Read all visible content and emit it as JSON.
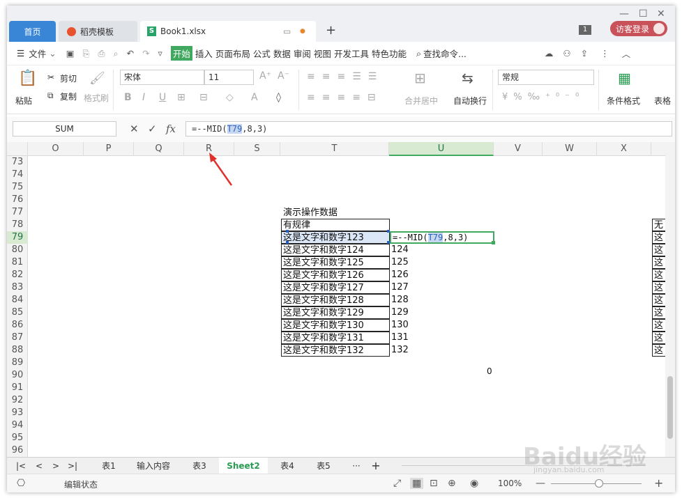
{
  "window": {
    "tabs": [
      {
        "label": "首页"
      },
      {
        "label": "稻壳模板"
      },
      {
        "label": "Book1.xlsx"
      }
    ],
    "notif_count": "1",
    "login_label": "访客登录"
  },
  "menu": {
    "items": [
      "文件",
      "开始",
      "插入",
      "页面布局",
      "公式",
      "数据",
      "审阅",
      "视图",
      "开发工具",
      "特色功能"
    ],
    "search": "查找命令..."
  },
  "ribbon": {
    "paste": "粘贴",
    "cut": "剪切",
    "copy": "复制",
    "format_painter": "格式刷",
    "font": "宋体",
    "size": "11",
    "number_format": "常规",
    "merge": "合并居中",
    "wrap": "自动换行",
    "cond_format": "条件格式",
    "table_style": "表格"
  },
  "formula_bar": {
    "name_box": "SUM",
    "fx": "fx",
    "formula_pre": "=--MID(",
    "formula_ref": "T79",
    "formula_post": ",8,3)"
  },
  "columns": [
    "O",
    "P",
    "Q",
    "R",
    "S",
    "T",
    "U",
    "V",
    "W",
    "X"
  ],
  "rows": [
    "73",
    "74",
    "75",
    "76",
    "77",
    "78",
    "79",
    "80",
    "81",
    "82",
    "83",
    "84",
    "85",
    "86",
    "87",
    "88",
    "89",
    "90",
    "91",
    "92",
    "93",
    "94",
    "95",
    "96"
  ],
  "sheet": {
    "title": "演示操作数据",
    "header": "有规律",
    "texts": [
      "这是文字和数字123",
      "这是文字和数字124",
      "这是文字和数字125",
      "这是文字和数字126",
      "这是文字和数字127",
      "这是文字和数字128",
      "这是文字和数字129",
      "这是文字和数字130",
      "这是文字和数字131",
      "这是文字和数字132"
    ],
    "results": [
      "124",
      "125",
      "126",
      "127",
      "128",
      "129",
      "130",
      "131",
      "132"
    ],
    "zero": "0",
    "right_header": "无",
    "right_char": "这"
  },
  "sheet_tabs": {
    "tabs": [
      "表1",
      "输入内容",
      "表3",
      "Sheet2",
      "表4",
      "表5"
    ],
    "active": "Sheet2",
    "more": "···"
  },
  "status": {
    "mode": "编辑状态",
    "zoom": "100%"
  },
  "watermark": {
    "logo": "Baidu经验",
    "url": "jingyan.baidu.com"
  }
}
